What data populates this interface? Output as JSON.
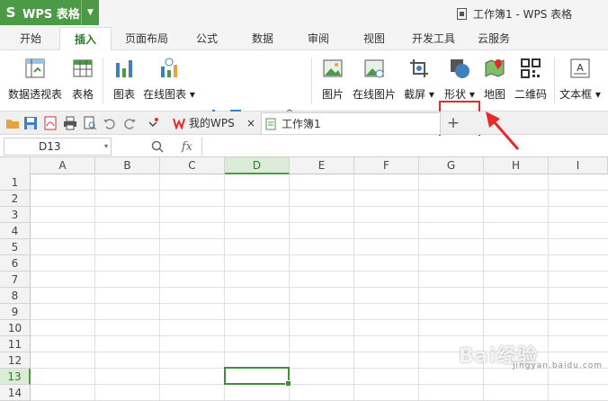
{
  "app": {
    "logo_glyph": "S",
    "name": "WPS 表格",
    "menu_arrow": "▼"
  },
  "window": {
    "title": "工作簿1 - WPS 表格"
  },
  "tabs": [
    {
      "label": "开始"
    },
    {
      "label": "插入",
      "active": true
    },
    {
      "label": "页面布局"
    },
    {
      "label": "公式"
    },
    {
      "label": "数据"
    },
    {
      "label": "审阅"
    },
    {
      "label": "视图"
    },
    {
      "label": "开发工具"
    },
    {
      "label": "云服务"
    }
  ],
  "ribbon": {
    "pivot_table": "数据透视表",
    "table": "表格",
    "chart": "图表",
    "online_chart": "在线图表 ▾",
    "picture": "图片",
    "online_picture": "在线图片",
    "screenshot": "截屏 ▾",
    "shapes": "形状 ▾",
    "map": "地图",
    "qrcode": "二维码",
    "textbox": "文本框 ▾"
  },
  "doc_tabs": {
    "mywps": "我的WPS",
    "workbook": "工作簿1",
    "close": "×",
    "add": "+"
  },
  "formula_bar": {
    "cell_ref": "D13",
    "dropdown": "▾",
    "fx": "fx",
    "value": ""
  },
  "sheet": {
    "columns": [
      "A",
      "B",
      "C",
      "D",
      "E",
      "F",
      "G",
      "H",
      "I"
    ],
    "rows": [
      "1",
      "2",
      "3",
      "4",
      "5",
      "6",
      "7",
      "8",
      "9",
      "10",
      "11",
      "12",
      "13",
      "14"
    ],
    "selected_column": "D",
    "selected_row": "13"
  },
  "colors": {
    "accent": "#4c9a46",
    "highlight": "#e42a2a"
  },
  "watermark": {
    "text": "Bai经验",
    "sub": "jingyan.baidu.com"
  }
}
